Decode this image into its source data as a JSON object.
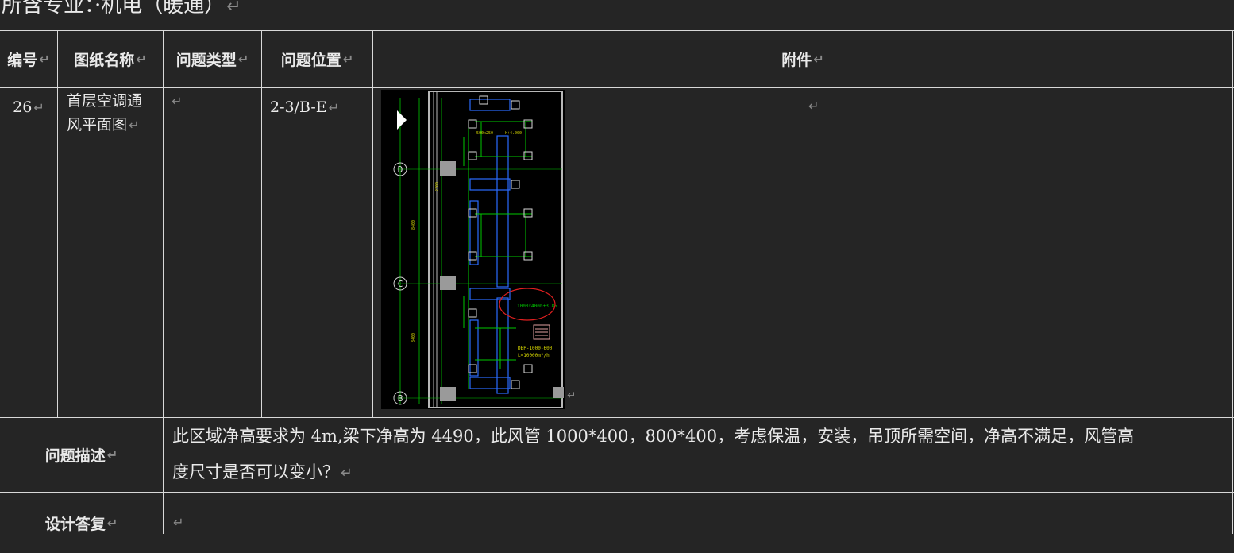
{
  "heading": "所含专业：·机电（暖通）",
  "table": {
    "headers": {
      "number": "编号",
      "drawing_name": "图纸名称",
      "issue_type": "问题类型",
      "issue_location": "问题位置",
      "attachment": "附件"
    },
    "row": {
      "number": "26",
      "drawing_name_line1": "首层空调通",
      "drawing_name_line2": "风平面图",
      "issue_type": "",
      "issue_location": "2-3/B-E"
    },
    "description_label": "问题描述",
    "description_line1": "此区域净高要求为 4m,梁下净高为 4490，此风管 1000*400，800*400，考虑保温，安装，吊顶所需空间，净高不满足，风管高",
    "description_line2": "度尺寸是否可以变小？",
    "reply_label": "设计答复",
    "reply_text": ""
  },
  "drawing": {
    "axis_labels": [
      "D",
      "C",
      "B"
    ],
    "annotations": [
      "1000x400",
      "h+3.85",
      "DBP-1000-600",
      "L=10000m³/h",
      "500x250",
      "h+4.000",
      "8400",
      "2700"
    ],
    "colors": {
      "background": "#000000",
      "duct": "#00c800",
      "text": "#d7d700",
      "highlight": "#e02020",
      "wall": "#b8b8b8"
    }
  }
}
